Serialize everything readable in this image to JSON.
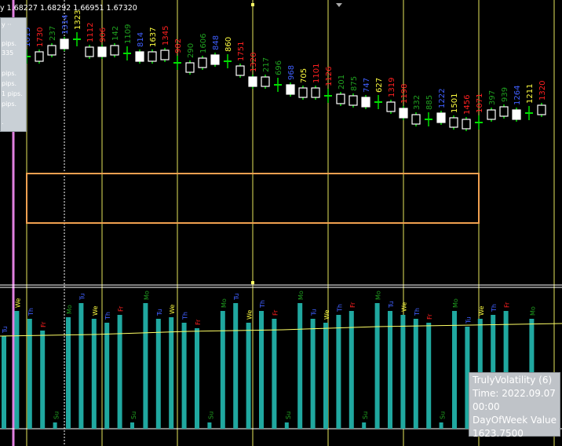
{
  "header": {
    "ohlc_text": "y  1.68227 1.68292 1.66951 1.67320"
  },
  "info_panel": {
    "title": "y ··",
    "lines": [
      "pips.",
      "335",
      "",
      "pips.",
      "pips.",
      "1 pips.",
      "pips.",
      "",
      "."
    ]
  },
  "chart_data": {
    "type": "candlestick",
    "colors": {
      "up": "#ffffff",
      "down": "#ffffff",
      "wick": "#00e000",
      "grid_vertical": "#ffff66",
      "rectangle": "#f0a050",
      "divider": "#ffffff",
      "hist": "#20a8a0",
      "avg_line": "#ffff66",
      "pink_line": "#e080e0"
    },
    "candles": [
      {
        "label": "1015",
        "label_color": "#4060ff"
      },
      {
        "label": "1730",
        "label_color": "#ff2020"
      },
      {
        "label": "237",
        "label_color": "#20a020"
      },
      {
        "label": "1314",
        "label_color": "#4060ff"
      },
      {
        "label": "1323",
        "label_color": "#ffff40"
      },
      {
        "label": "1112",
        "label_color": "#ff2020"
      },
      {
        "label": "906",
        "label_color": "#ff2020"
      },
      {
        "label": "142",
        "label_color": "#20a020"
      },
      {
        "label": "1109",
        "label_color": "#20a020"
      },
      {
        "label": "814",
        "label_color": "#4060ff"
      },
      {
        "label": "1637",
        "label_color": "#ffff40"
      },
      {
        "label": "1345",
        "label_color": "#ff2020"
      },
      {
        "label": "982",
        "label_color": "#ff2020"
      },
      {
        "label": "290",
        "label_color": "#20a020"
      },
      {
        "label": "1606",
        "label_color": "#20a020"
      },
      {
        "label": "848",
        "label_color": "#4060ff"
      },
      {
        "label": "860",
        "label_color": "#ffff40"
      },
      {
        "label": "1751",
        "label_color": "#ff2020"
      },
      {
        "label": "1320",
        "label_color": "#ff2020"
      },
      {
        "label": "217",
        "label_color": "#20a020"
      },
      {
        "label": "696",
        "label_color": "#20a020"
      },
      {
        "label": "968",
        "label_color": "#4060ff"
      },
      {
        "label": "705",
        "label_color": "#ffff40"
      },
      {
        "label": "1101",
        "label_color": "#ff2020"
      },
      {
        "label": "1126",
        "label_color": "#ff2020"
      },
      {
        "label": "201",
        "label_color": "#20a020"
      },
      {
        "label": "875",
        "label_color": "#20a020"
      },
      {
        "label": "747",
        "label_color": "#4060ff"
      },
      {
        "label": "627",
        "label_color": "#ffff40"
      },
      {
        "label": "1319",
        "label_color": "#ff2020"
      },
      {
        "label": "1198",
        "label_color": "#ff2020"
      },
      {
        "label": "332",
        "label_color": "#20a020"
      },
      {
        "label": "885",
        "label_color": "#20a020"
      },
      {
        "label": "1222",
        "label_color": "#4060ff"
      },
      {
        "label": "1501",
        "label_color": "#ffff40"
      },
      {
        "label": "1456",
        "label_color": "#ff2020"
      },
      {
        "label": "1071",
        "label_color": "#ff2020"
      },
      {
        "label": "397",
        "label_color": "#20a020"
      },
      {
        "label": "939",
        "label_color": "#20a020"
      },
      {
        "label": "1264",
        "label_color": "#4060ff"
      },
      {
        "label": "1211",
        "label_color": "#ffff40"
      },
      {
        "label": "1320",
        "label_color": "#ff2020"
      }
    ],
    "indicator_name": "TrulyVolatility (6)",
    "day_labels": [
      "Su",
      "Mo",
      "Tu",
      "We",
      "Th",
      "Fr"
    ]
  },
  "tooltip": {
    "line1": "TrulyVolatility (6)",
    "line2": "Time: 2022.09.07",
    "line3": "00:00",
    "line4": "DayOfWeek Value:",
    "line5": "1623.7500"
  }
}
